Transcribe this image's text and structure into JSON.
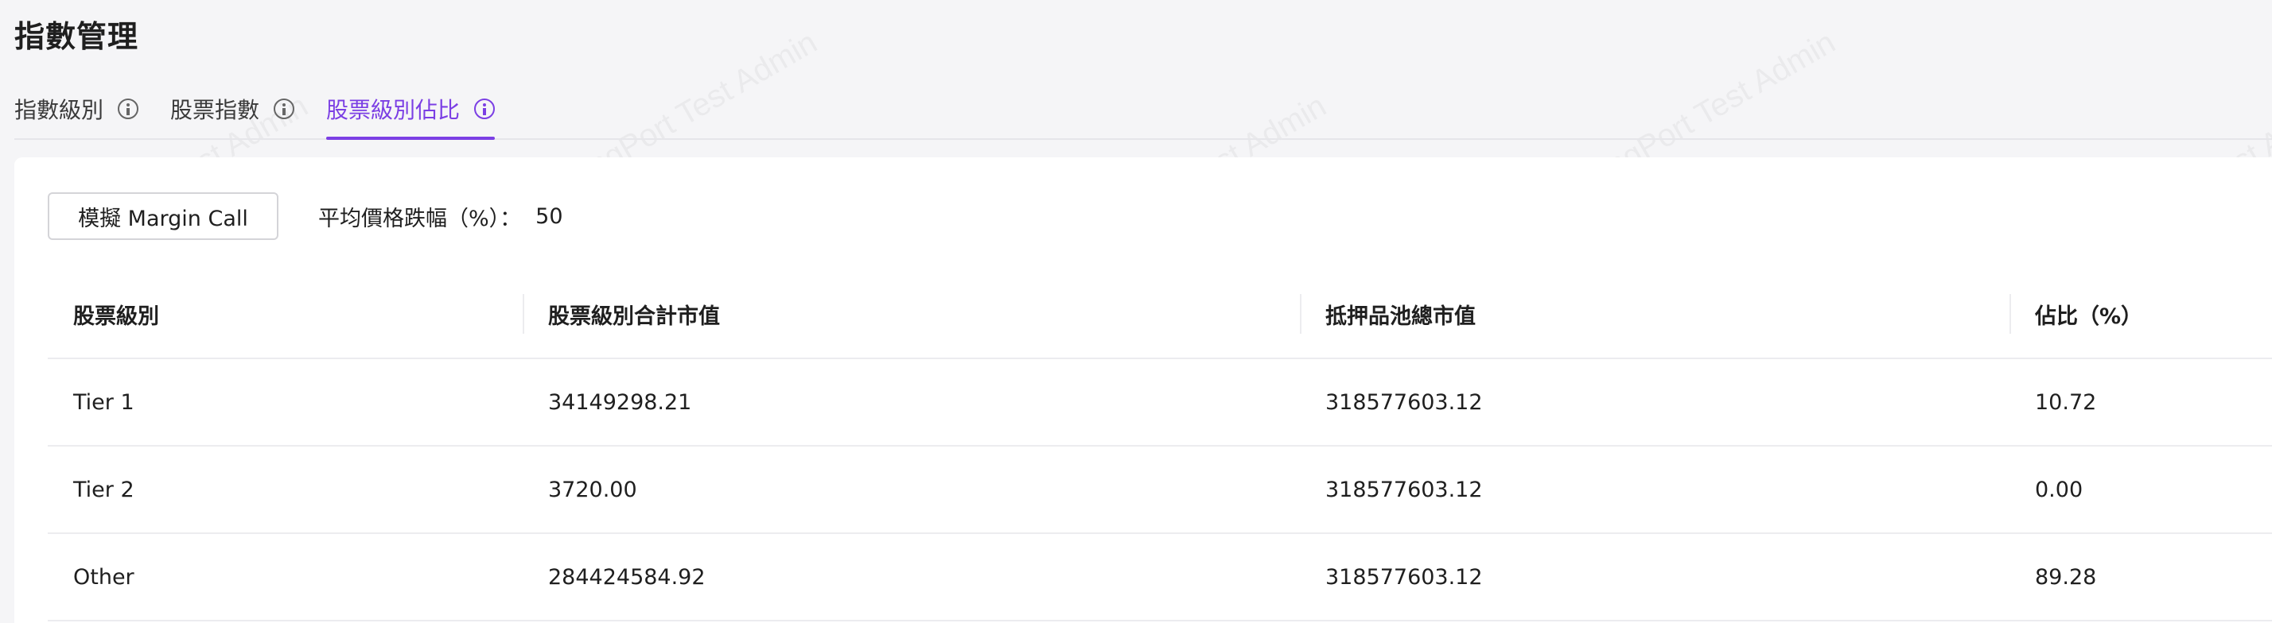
{
  "page": {
    "title": "指數管理"
  },
  "tabs": [
    {
      "label": "指數級別",
      "active": false,
      "icon": "info-circle-icon"
    },
    {
      "label": "股票指數",
      "active": false,
      "icon": "info-circle-icon"
    },
    {
      "label": "股票級別佔比",
      "active": true,
      "icon": "info-circle-icon"
    }
  ],
  "toolbar": {
    "simulate_button_label": "模擬 Margin Call",
    "avg_drop_label": "平均價格跌幅（%）：",
    "avg_drop_value": "50"
  },
  "table": {
    "headers": [
      "股票級別",
      "股票級別合計市值",
      "抵押品池總市值",
      "佔比（%）"
    ],
    "rows": [
      [
        "Tier 1",
        "34149298.21",
        "318577603.12",
        "10.72"
      ],
      [
        "Tier 2",
        "3720.00",
        "318577603.12",
        "0.00"
      ],
      [
        "Other",
        "284424584.92",
        "318577603.12",
        "89.28"
      ]
    ]
  },
  "watermark": {
    "text": "LongPort Test Admin"
  },
  "colors": {
    "accent": "#7b3fe4",
    "background": "#f5f5f7",
    "card": "#ffffff",
    "divider": "#ececef"
  }
}
